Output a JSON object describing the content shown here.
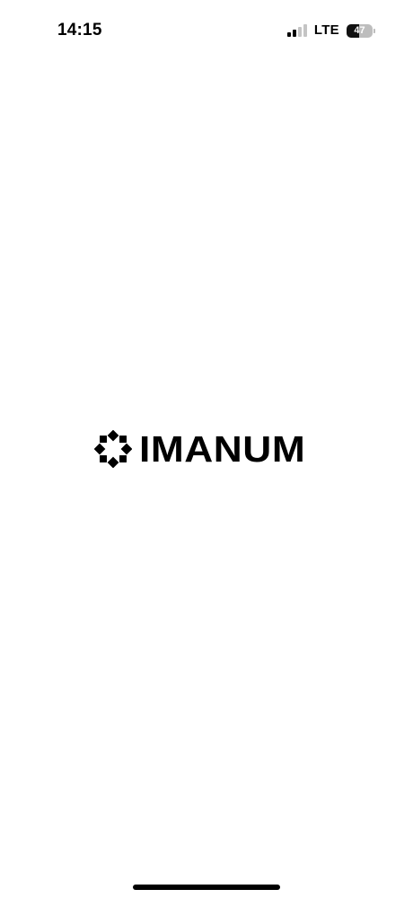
{
  "status_bar": {
    "time": "14:15",
    "network": "LTE",
    "battery_percent": "47",
    "battery_level": 0.47,
    "signal_bars_active": 2,
    "signal_bars_total": 4
  },
  "splash": {
    "logo_icon": "imanum-logo-icon",
    "brand_name": "IMANUM"
  },
  "colors": {
    "background": "#ffffff",
    "foreground": "#000000",
    "inactive_signal": "#c4c4c4"
  }
}
